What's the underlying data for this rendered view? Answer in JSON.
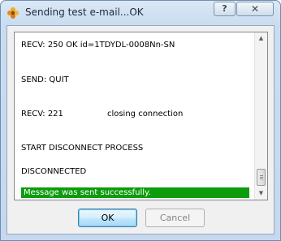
{
  "window": {
    "title": "Sending test e-mail...OK",
    "help_label": "?",
    "close_label": "✕"
  },
  "icons": {
    "app": "flower-icon",
    "help": "help-icon",
    "close": "close-icon",
    "scroll_up": "scroll-up-arrow-icon",
    "scroll_down": "scroll-down-arrow-icon"
  },
  "log": {
    "lines": [
      "RECV: 250 OK id=1TDYDL-0008Nn-SN",
      "SEND: QUIT",
      "RECV: 221                 closing connection",
      "START DISCONNECT PROCESS",
      "DISCONNECTED"
    ],
    "success_message": "Message was sent successfully.",
    "success_color": "#0c9c0c"
  },
  "buttons": {
    "ok": "OK",
    "cancel": "Cancel"
  },
  "scroll": {
    "up": "▲",
    "down": "▼"
  }
}
